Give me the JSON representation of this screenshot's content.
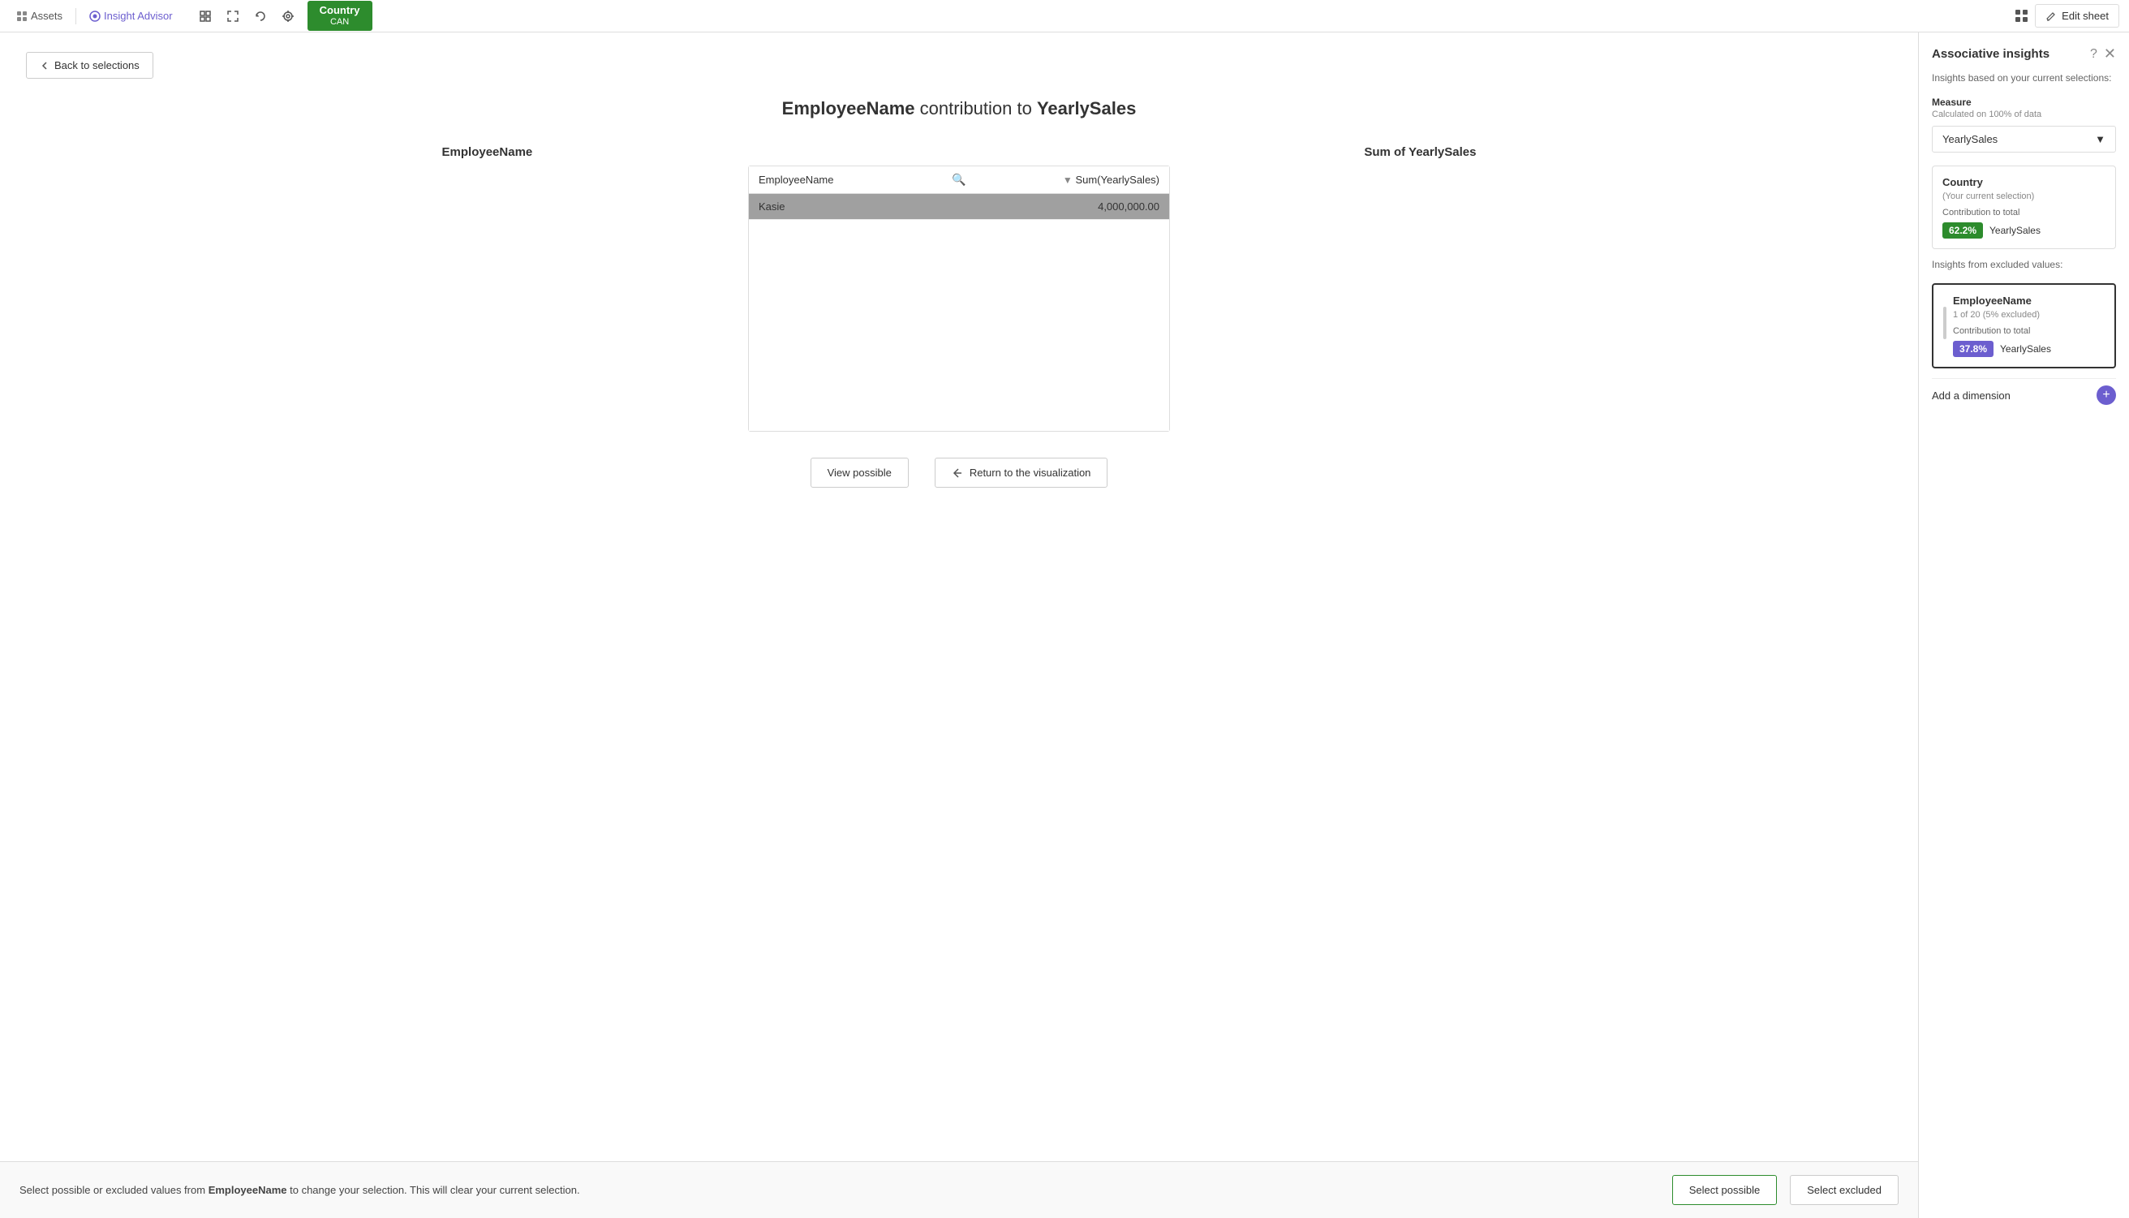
{
  "topNav": {
    "assets_label": "Assets",
    "insight_advisor_label": "Insight Advisor",
    "country_tab_label": "Country",
    "country_tab_sub": "CAN",
    "edit_sheet_label": "Edit sheet"
  },
  "content": {
    "back_button_label": "Back to selections",
    "main_title_part1": "EmployeeName",
    "main_title_middle": " contribution to ",
    "main_title_part2": "YearlySales",
    "col_header_left": "EmployeeName",
    "col_header_right": "Sum of YearlySales",
    "table": {
      "header_left": "EmployeeName",
      "header_right": "Sum(YearlySales)",
      "rows": [
        {
          "left": "Kasie",
          "right": "4,000,000.00",
          "selected": true
        }
      ]
    },
    "view_possible_label": "View possible",
    "return_viz_label": "Return to the visualization"
  },
  "bottomBar": {
    "text_prefix": "Select possible or excluded values from ",
    "field_name": "EmployeeName",
    "text_suffix": " to change your selection. This will clear your current selection.",
    "select_possible_label": "Select possible",
    "select_excluded_label": "Select excluded"
  },
  "rightPanel": {
    "title": "Associative insights",
    "subtitle": "Insights based on your current selections:",
    "measure_label": "Measure",
    "measure_sublabel": "Calculated on 100% of data",
    "measure_value": "YearlySales",
    "current_selection_card": {
      "title": "Country",
      "subtitle": "(Your current selection)",
      "contribution_label": "Contribution to total",
      "badge": "62.2%",
      "field": "YearlySales"
    },
    "excluded_section_label": "Insights from excluded values:",
    "excluded_card": {
      "title": "EmployeeName",
      "subtitle": "1 of 20 (5% excluded)",
      "contribution_label": "Contribution to total",
      "badge": "37.8%",
      "field": "YearlySales"
    },
    "add_dimension_label": "Add a dimension"
  }
}
